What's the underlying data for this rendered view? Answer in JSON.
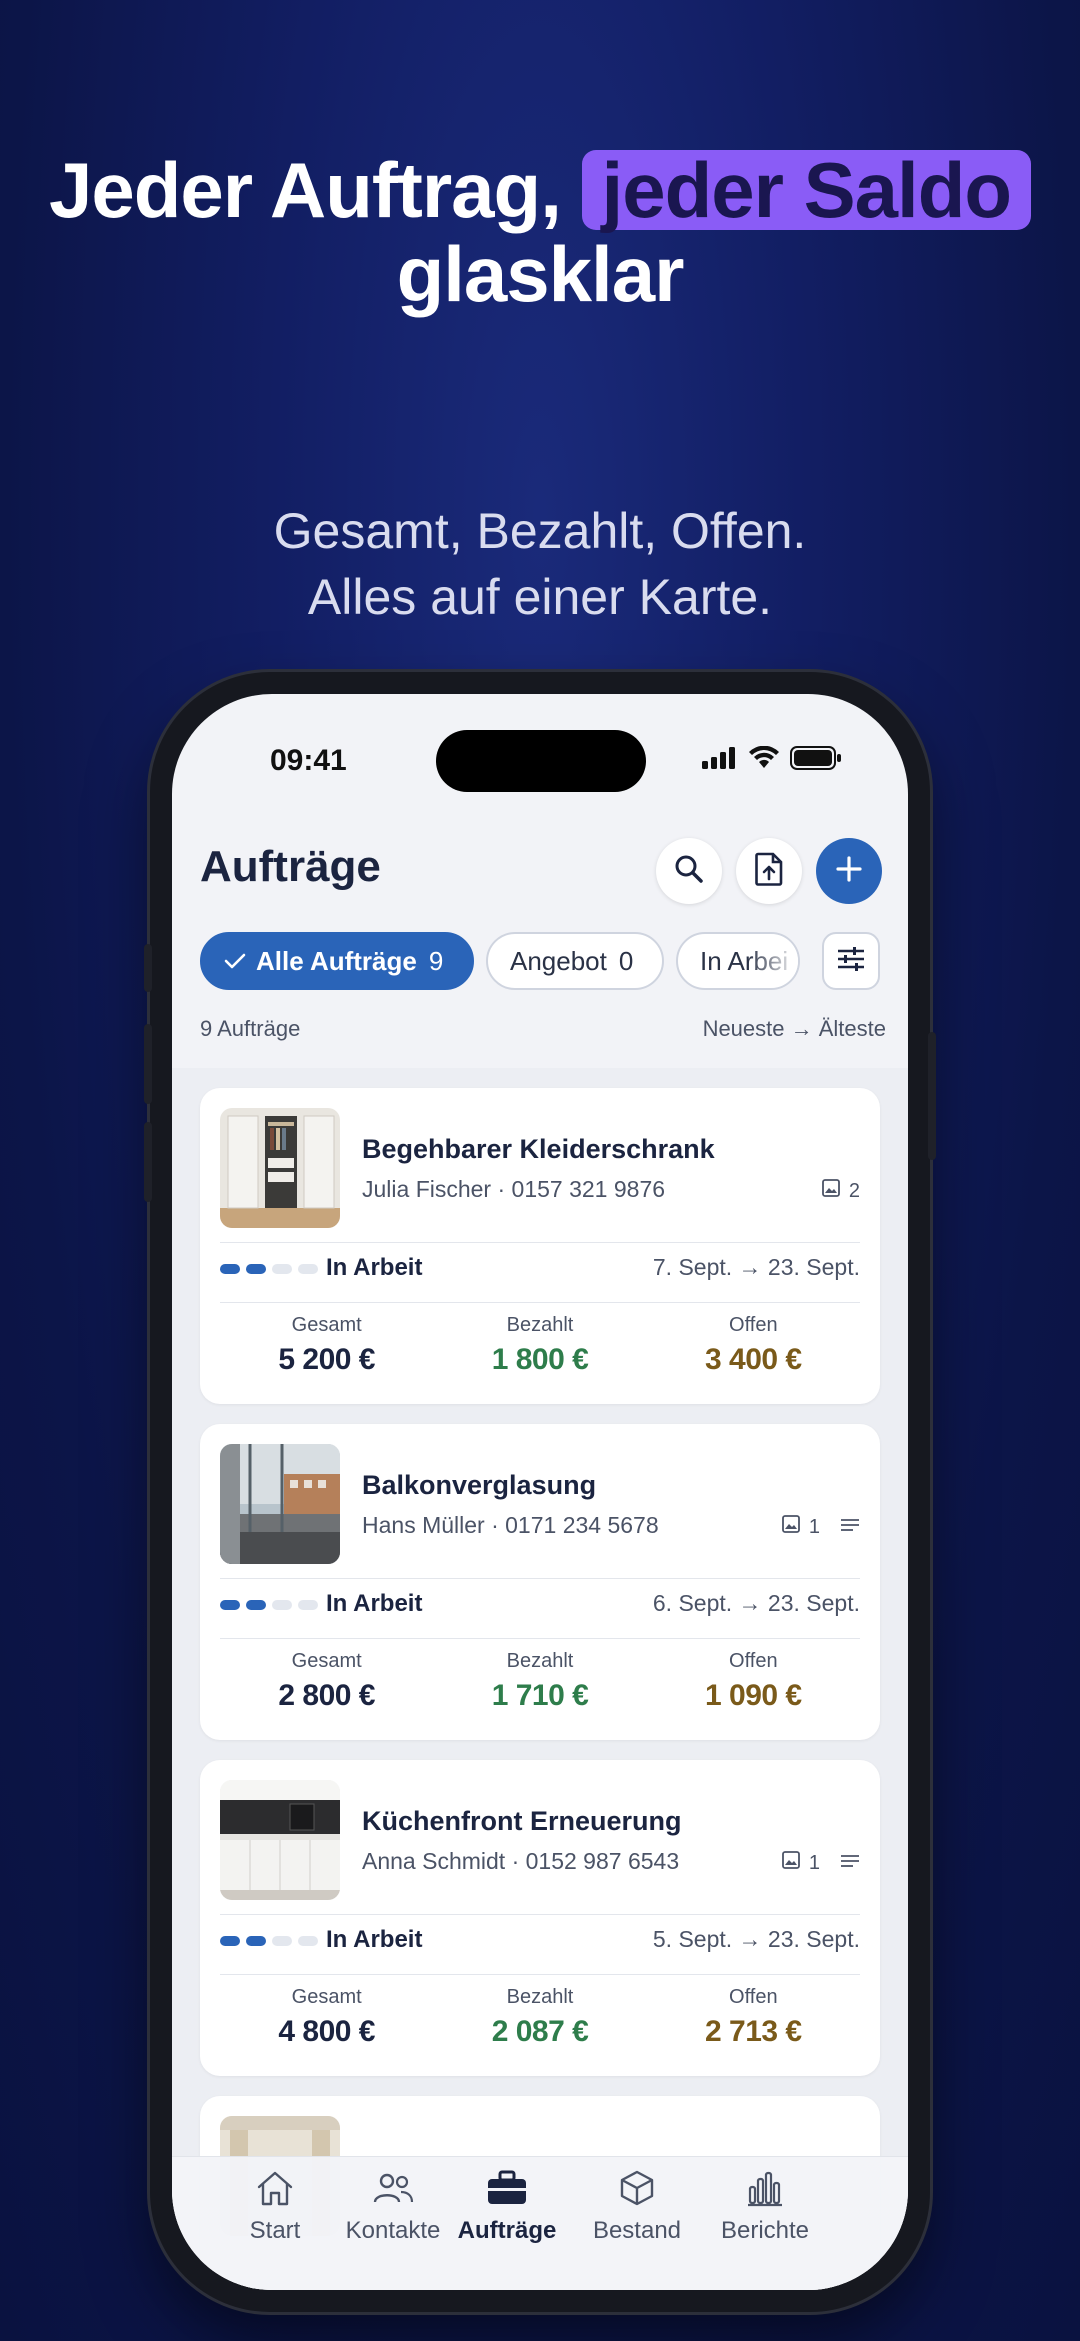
{
  "headline": {
    "line1": "Jeder Auftrag,",
    "highlight": "jeder Saldo",
    "line2": "glasklar"
  },
  "subline": {
    "line1": "Gesamt, Bezahlt, Offen.",
    "line2": "Alles auf einer Karte."
  },
  "statusbar": {
    "time": "09:41"
  },
  "header": {
    "title": "Aufträge"
  },
  "chips": [
    {
      "label": "Alle Aufträge",
      "count": "9",
      "active": true
    },
    {
      "label": "Angebot",
      "count": "0"
    },
    {
      "label": "In Arbei",
      "count": ""
    }
  ],
  "meta": {
    "count_text": "9 Aufträge",
    "sort_text": "Neueste → Älteste"
  },
  "orders": [
    {
      "title": "Begehbarer Kleiderschrank",
      "customer": "Julia Fischer  · 0157 321 9876",
      "image_count": "2",
      "status": "In Arbeit",
      "progress_steps_done": 2,
      "progress_steps_total": 4,
      "dates": "7. Sept. → 23. Sept.",
      "total_label": "Gesamt",
      "total": "5 200 €",
      "paid_label": "Bezahlt",
      "paid": "1 800 €",
      "open_label": "Offen",
      "open": "3 400 €"
    },
    {
      "title": "Balkonverglasung",
      "customer": "Hans Müller  · 0171 234 5678",
      "image_count": "1",
      "status": "In Arbeit",
      "progress_steps_done": 2,
      "progress_steps_total": 4,
      "dates": "6. Sept. → 23. Sept.",
      "total_label": "Gesamt",
      "total": "2 800 €",
      "paid_label": "Bezahlt",
      "paid": "1 710 €",
      "open_label": "Offen",
      "open": "1 090 €"
    },
    {
      "title": "Küchenfront Erneuerung",
      "customer": "Anna Schmidt  · 0152 987 6543",
      "image_count": "1",
      "status": "In Arbeit",
      "progress_steps_done": 2,
      "progress_steps_total": 4,
      "dates": "5. Sept. → 23. Sept.",
      "total_label": "Gesamt",
      "total": "4 800 €",
      "paid_label": "Bezahlt",
      "paid": "2 087 €",
      "open_label": "Offen",
      "open": "2 713 €"
    }
  ],
  "tabs": [
    {
      "label": "Start",
      "icon": "home-icon"
    },
    {
      "label": "Kontakte",
      "icon": "contacts-icon"
    },
    {
      "label": "Aufträge",
      "icon": "briefcase-icon",
      "active": true
    },
    {
      "label": "Bestand",
      "icon": "box-icon"
    },
    {
      "label": "Berichte",
      "icon": "chart-icon"
    }
  ],
  "colors": {
    "accent": "#2a64b8",
    "highlight": "#8a5cf6",
    "paid": "#2e7d4b",
    "open": "#7a5a1a",
    "background": "#121e63"
  }
}
